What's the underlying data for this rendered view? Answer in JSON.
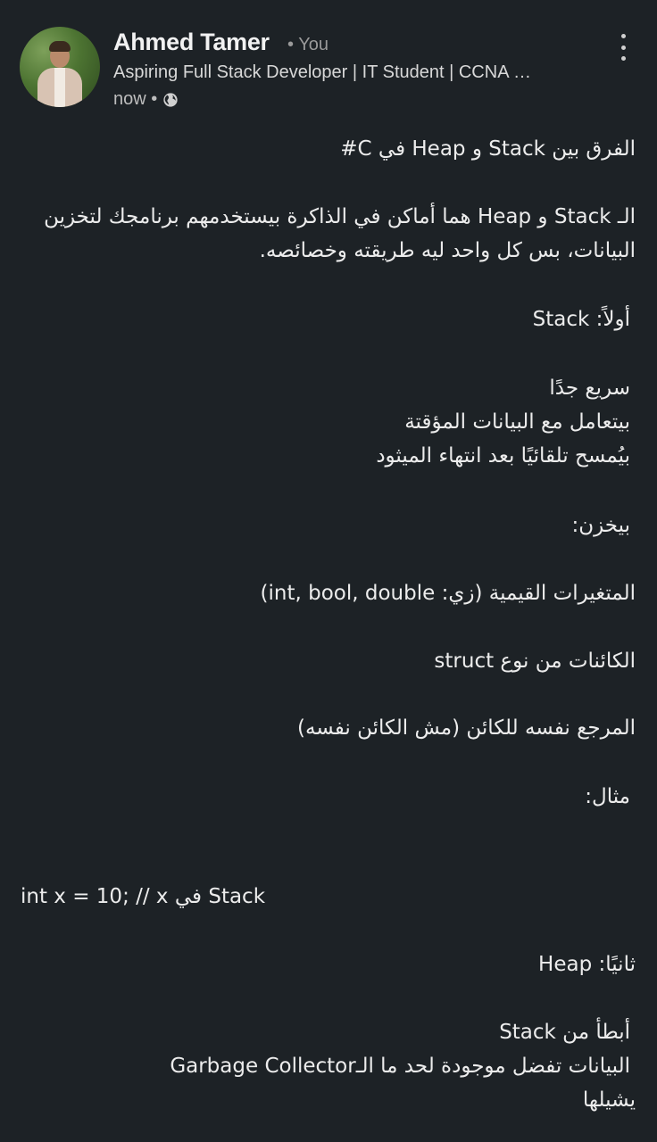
{
  "post": {
    "author_name": "Ahmed Tamer",
    "you_label": "• You",
    "headline": "Aspiring Full Stack Developer | IT Student | CCNA …",
    "time": "now •",
    "visibility_icon": "globe-icon",
    "menu_icon": "more-vertical-icon"
  },
  "content": {
    "title": "الفرق بين Stack و Heap في C#",
    "intro_line1": "الـ Stack و Heap هما أماكن في الذاكرة بيستخدمهم برنامجك لتخزين",
    "intro_line2": "البيانات، بس كل واحد ليه طريقته وخصائصه.",
    "stack_heading": "أولاً: Stack",
    "stack_point1": "سريع جدًا",
    "stack_point2": "بيتعامل مع البيانات المؤقتة",
    "stack_point3": "بيُمسح تلقائيًا بعد انتهاء الميثود",
    "stores_label": "بيخزن:",
    "stores_item1": "المتغيرات القيمية (زي: int, bool, double)",
    "stores_item2": "الكائنات من نوع struct",
    "stores_item3": "المرجع نفسه للكائن (مش الكائن نفسه)",
    "example_label": "مثال:",
    "code_example": "int x = 10; // x في Stack",
    "heap_heading": "ثانيًا: Heap",
    "heap_point1": "أبطأ من Stack",
    "heap_point2": "البيانات تفضل موجودة لحد ما الـGarbage Collector",
    "heap_point3": "يشيلها"
  }
}
